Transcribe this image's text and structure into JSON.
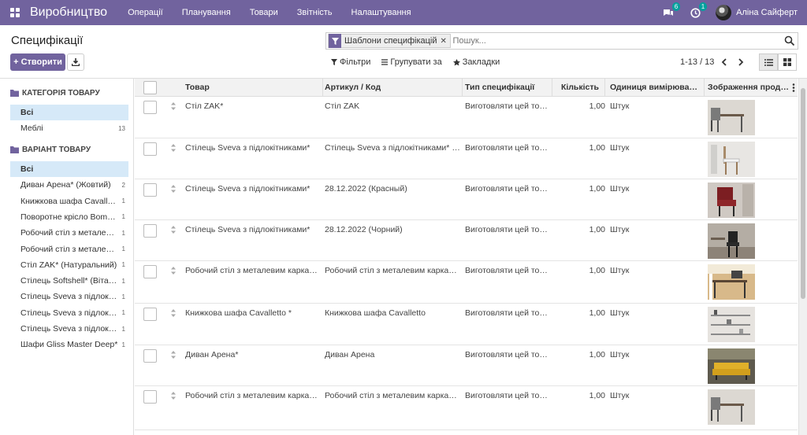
{
  "navbar": {
    "app_title": "Виробництво",
    "menu": [
      "Операції",
      "Планування",
      "Товари",
      "Звітність",
      "Налаштування"
    ],
    "chat_badge": "6",
    "activity_badge": "1",
    "user_name": "Аліна Сайферт"
  },
  "page": {
    "title": "Специфікації",
    "create_label": "Створити"
  },
  "search": {
    "facet_label": "Шаблони специфікацій",
    "placeholder": "Пошук..."
  },
  "filters": {
    "filters_label": "Фільтри",
    "groupby_label": "Групувати за",
    "favorites_label": "Закладки"
  },
  "pager": {
    "value": "1-13 / 13"
  },
  "side_panel": {
    "category_header": "КАТЕГОРІЯ ТОВАРУ",
    "category_items": [
      {
        "label": "Всі",
        "count": "",
        "active": true
      },
      {
        "label": "Меблі",
        "count": "13",
        "active": false
      }
    ],
    "variant_header": "ВАРІАНТ ТОВАРУ",
    "variant_items": [
      {
        "label": "Всі",
        "count": "",
        "active": true
      },
      {
        "label": "Диван Арена* (Жовтий)",
        "count": "2",
        "active": false
      },
      {
        "label": "Книжкова шафа Cavalletto *",
        "count": "1",
        "active": false
      },
      {
        "label": "Поворотне крісло Bombo*",
        "count": "1",
        "active": false
      },
      {
        "label": "Робочий стіл з металевим каркасом",
        "count": "1",
        "active": false
      },
      {
        "label": "Робочий стіл з металевим каркасом",
        "count": "1",
        "active": false
      },
      {
        "label": "Стіл ZAK* (Натуральний)",
        "count": "1",
        "active": false
      },
      {
        "label": "Стілець Softshell* (Віталіс)",
        "count": "1",
        "active": false
      },
      {
        "label": "Стілець Sveva з підлокітниками*",
        "count": "1",
        "active": false
      },
      {
        "label": "Стілець Sveva з підлокітниками*",
        "count": "1",
        "active": false
      },
      {
        "label": "Стілець Sveva з підлокітниками*",
        "count": "1",
        "active": false
      },
      {
        "label": "Шафи Gliss Master Deep*",
        "count": "1",
        "active": false
      }
    ]
  },
  "table": {
    "columns": [
      "Товар",
      "Артикул / Код",
      "Тип специфікації",
      "Кількість",
      "Одиниця вимірювання",
      "Зображення продукції"
    ],
    "rows": [
      {
        "product": "Стіл ZAK*",
        "reference": "Стіл ZAK",
        "type": "Виготовляти цей товар",
        "qty": "1,00",
        "uom": "Штук",
        "image": "desk-chair"
      },
      {
        "product": "Стілець Sveva з підлокітниками*",
        "reference": "Стілець Sveva з підлокітниками* (натуральний)",
        "type": "Виготовляти цей товар",
        "qty": "1,00",
        "uom": "Штук",
        "image": "white-chair"
      },
      {
        "product": "Стілець Sveva з підлокітниками*",
        "reference": "28.12.2022 (Красный)",
        "type": "Виготовляти цей товар",
        "qty": "1,00",
        "uom": "Штук",
        "image": "red-chair"
      },
      {
        "product": "Стілець Sveva з підлокітниками*",
        "reference": "28.12.2022 (Чорний)",
        "type": "Виготовляти цей товар",
        "qty": "1,00",
        "uom": "Штук",
        "image": "black-chair"
      },
      {
        "product": "Робочий стіл з металевим каркасом",
        "reference": "Робочий стіл з металевим каркасом",
        "type": "Виготовляти цей товар",
        "qty": "1,00",
        "uom": "Штук",
        "image": "office-desk"
      },
      {
        "product": "Книжкова шафа Cavalletto *",
        "reference": "Книжкова шафа Cavalletto",
        "type": "Виготовляти цей товар",
        "qty": "1,00",
        "uom": "Штук",
        "image": "bookshelf"
      },
      {
        "product": "Диван Арена*",
        "reference": "Диван Арена",
        "type": "Виготовляти цей товар",
        "qty": "1,00",
        "uom": "Штук",
        "image": "yellow-sofa"
      },
      {
        "product": "Робочий стіл з металевим каркасом",
        "reference": "Робочий стіл з металевим каркасом",
        "type": "Виготовляти цей товар",
        "qty": "1,00",
        "uom": "Штук",
        "image": "desk-chair"
      }
    ]
  },
  "colors": {
    "brand": "#71639e",
    "accent": "#00a09d",
    "active_bg": "#d6e9f8"
  }
}
